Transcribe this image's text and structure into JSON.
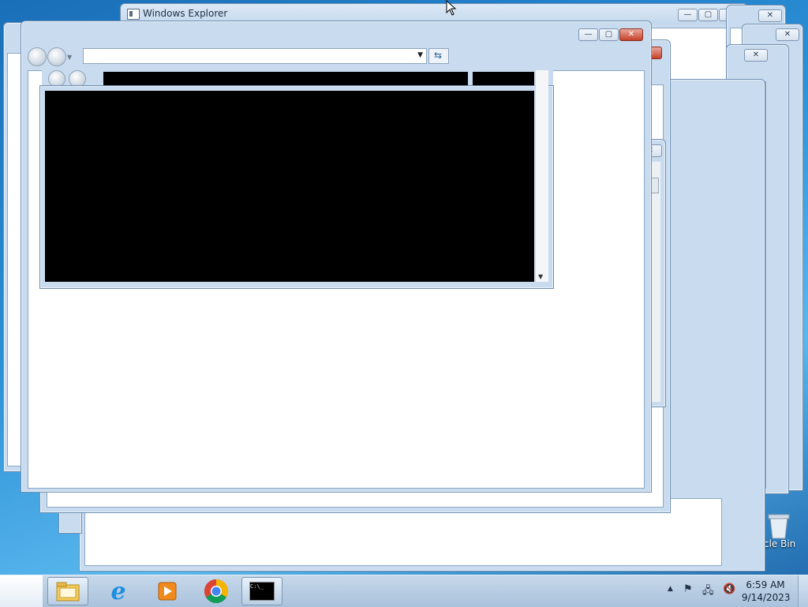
{
  "windows": {
    "explorer_title": "Windows Explorer",
    "caption_minimize": "—",
    "caption_maximize": "▢",
    "caption_close": "✕"
  },
  "desktop": {
    "recycle_bin_label": "cle Bin"
  },
  "taskbar": {
    "clock_time": "6:59 AM",
    "clock_date": "9/14/2023",
    "apps": [
      "Windows Explorer",
      "Internet Explorer",
      "Windows Media Player",
      "Google Chrome",
      "Command Prompt"
    ],
    "cmd_icon_text": "C:\\_"
  },
  "tray": {
    "show_hidden": "▲",
    "icons": [
      "action-center-icon",
      "network-icon",
      "volume-muted-icon"
    ]
  },
  "colors": {
    "accent_close": "#c7412b",
    "window_frame": "#c9dcef",
    "desktop": "#2a8fd6"
  }
}
